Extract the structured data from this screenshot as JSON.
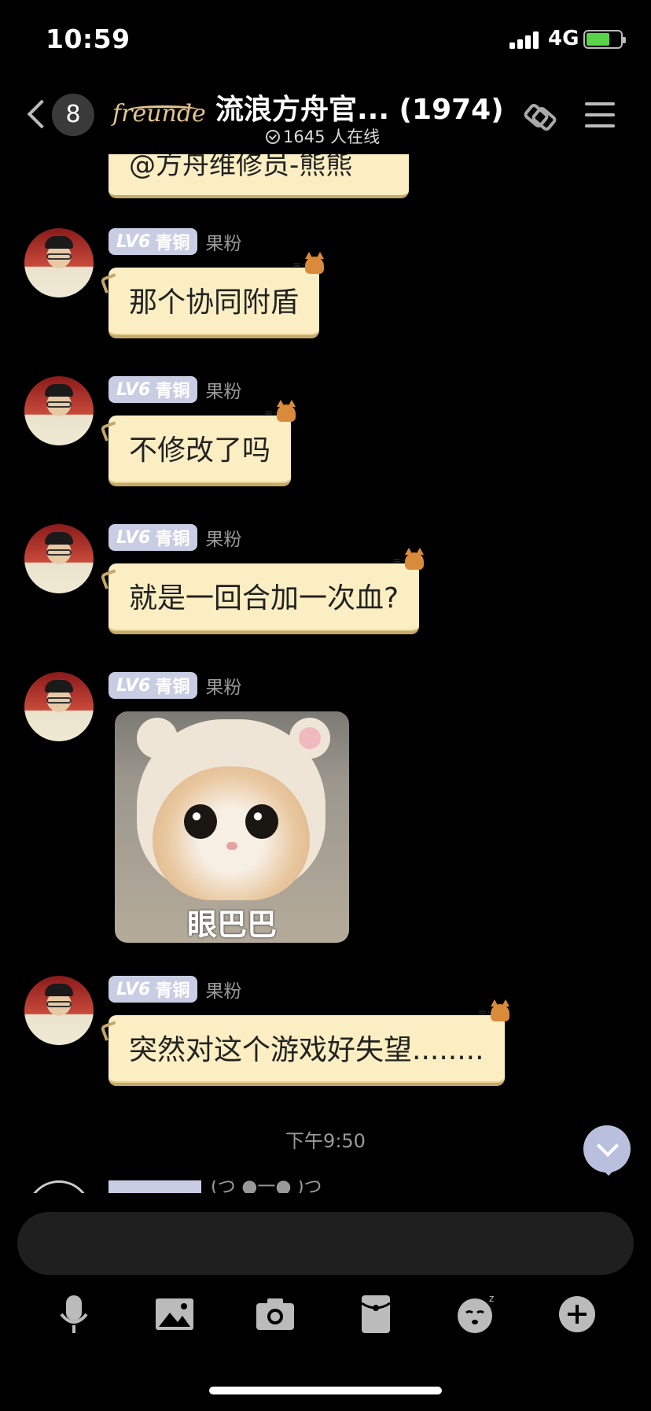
{
  "status_bar": {
    "time": "10:59",
    "network": "4G",
    "battery_color": "#5ad34a"
  },
  "header": {
    "unread_count": "8",
    "brand": "freunde",
    "title": "流浪方舟官... (1974)",
    "online_text": "1645 人在线"
  },
  "messages": {
    "top_partial": "@方舟维修员-熊熊",
    "items": [
      {
        "badge_level": "LV6",
        "badge_rank": "青铜",
        "nickname": "果粉",
        "text": "那个协同附盾"
      },
      {
        "badge_level": "LV6",
        "badge_rank": "青铜",
        "nickname": "果粉",
        "text": "不修改了吗"
      },
      {
        "badge_level": "LV6",
        "badge_rank": "青铜",
        "nickname": "果粉",
        "text": "就是一回合加一次血?"
      },
      {
        "badge_level": "LV6",
        "badge_rank": "青铜",
        "nickname": "果粉",
        "sticker_caption": "眼巴巴"
      },
      {
        "badge_level": "LV6",
        "badge_rank": "青铜",
        "nickname": "果粉",
        "text": "突然对这个游戏好失望........"
      }
    ],
    "timestamp": "下午9:50",
    "partial_nickname": "(づ ●一● )づ"
  },
  "input": {
    "placeholder": ""
  },
  "toolbar": {
    "icons": [
      "microphone-icon",
      "image-icon",
      "camera-icon",
      "red-packet-icon",
      "emoji-icon",
      "plus-icon"
    ]
  },
  "colors": {
    "bubble": "#fbeec2",
    "badge": "#c9cde3",
    "background": "#000000"
  }
}
